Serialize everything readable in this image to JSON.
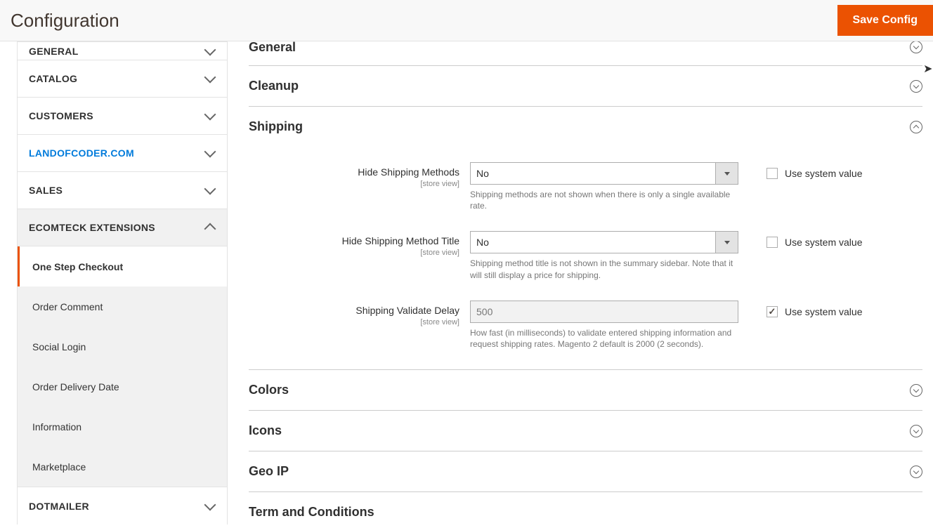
{
  "header": {
    "title": "Configuration",
    "save_label": "Save Config"
  },
  "sidebar": {
    "items": [
      {
        "label": "GENERAL"
      },
      {
        "label": "CATALOG"
      },
      {
        "label": "CUSTOMERS"
      },
      {
        "label": "LANDOFCODER.COM"
      },
      {
        "label": "SALES"
      },
      {
        "label": "ECOMTECK EXTENSIONS"
      },
      {
        "label": "DOTMAILER"
      }
    ],
    "sub_items": [
      {
        "label": "One Step Checkout"
      },
      {
        "label": "Order Comment"
      },
      {
        "label": "Social Login"
      },
      {
        "label": "Order Delivery Date"
      },
      {
        "label": "Information"
      },
      {
        "label": "Marketplace"
      }
    ]
  },
  "sections": {
    "general": "General",
    "cleanup": "Cleanup",
    "shipping": "Shipping",
    "colors": "Colors",
    "icons": "Icons",
    "geoip": "Geo IP",
    "terms": "Term and Conditions"
  },
  "fields": {
    "hide_methods": {
      "label": "Hide Shipping Methods",
      "scope": "[store view]",
      "value": "No",
      "hint": "Shipping methods are not shown when there is only a single available rate.",
      "use_system": "Use system value"
    },
    "hide_title": {
      "label": "Hide Shipping Method Title",
      "scope": "[store view]",
      "value": "No",
      "hint": "Shipping method title is not shown in the summary sidebar. Note that it will still display a price for shipping.",
      "use_system": "Use system value"
    },
    "validate_delay": {
      "label": "Shipping Validate Delay",
      "scope": "[store view]",
      "value": "500",
      "hint": "How fast (in milliseconds) to validate entered shipping information and request shipping rates. Magento 2 default is 2000 (2 seconds).",
      "use_system": "Use system value"
    }
  }
}
